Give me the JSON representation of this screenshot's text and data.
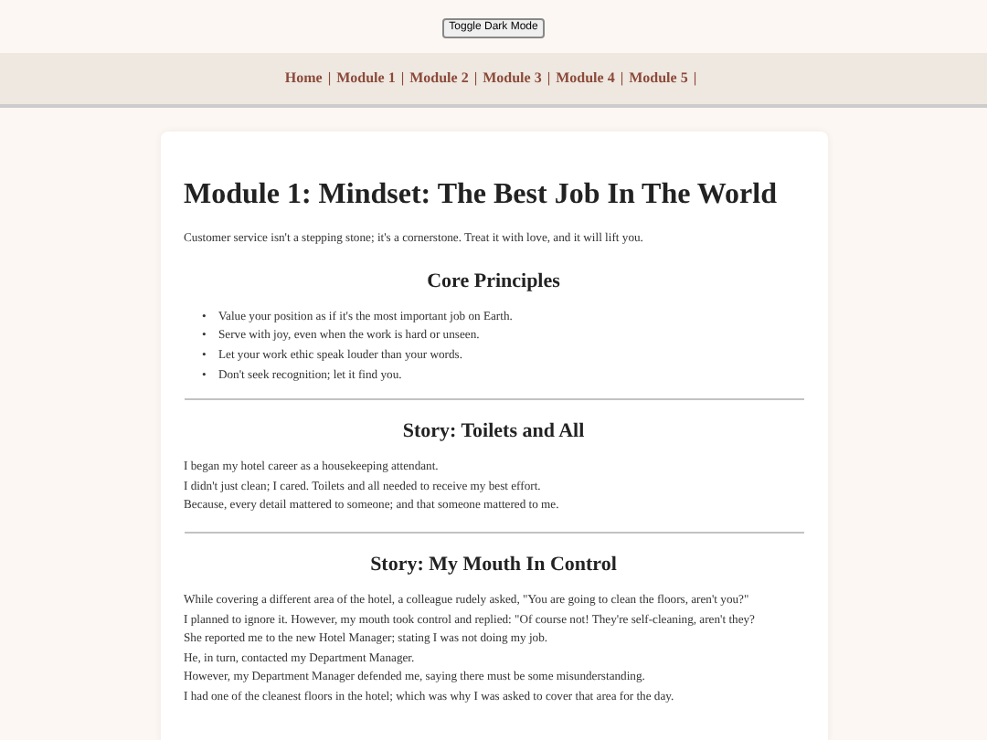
{
  "toggle_button": {
    "label": "Toggle Dark Mode"
  },
  "nav": [
    {
      "label": "Home",
      "separator": "|"
    },
    {
      "label": "Module 1",
      "separator": "|"
    },
    {
      "label": "Module 2",
      "separator": "|"
    },
    {
      "label": "Module 3",
      "separator": "|"
    },
    {
      "label": "Module 4",
      "separator": "|"
    },
    {
      "label": "Module 5",
      "separator": "|"
    }
  ],
  "title": "Module 1: Mindset: The Best Job In The World",
  "intro": "Customer service isn't a stepping stone; it's a cornerstone. Treat it with love, and it will lift you.",
  "sections": [
    {
      "heading": "Core Principles",
      "kind": "list",
      "bullet": "•",
      "lines": [
        "Value your position as if it's the most important job on Earth.",
        "Serve with joy, even when the work is hard or unseen.",
        "Let your work ethic speak louder than your words.",
        "Don't seek recognition; let it find you."
      ]
    },
    {
      "heading": "Story: Toilets and All",
      "kind": "lines",
      "lines": [
        "I began my hotel career as a housekeeping attendant.",
        "I didn't just clean; I cared. Toilets and all needed to receive my best effort.",
        "Because, every detail mattered to someone; and that someone mattered to me."
      ]
    },
    {
      "heading": "Story: My Mouth In Control",
      "kind": "lines",
      "lines": [
        "While covering a different area of the hotel, a colleague rudely asked, \"You are going to clean the floors, aren't you?\"",
        "I planned to ignore it. However, my mouth took control and replied: \"Of course not! They're self-cleaning, aren't they?",
        "She reported me to the new Hotel Manager; stating I was not doing my job.",
        "He, in turn, contacted my Department Manager.",
        "However, my Department Manager defended me, saying there must be some misunderstanding.",
        "I had one of the cleanest floors in the hotel; which was why I was asked to cover that area for the day."
      ]
    }
  ]
}
